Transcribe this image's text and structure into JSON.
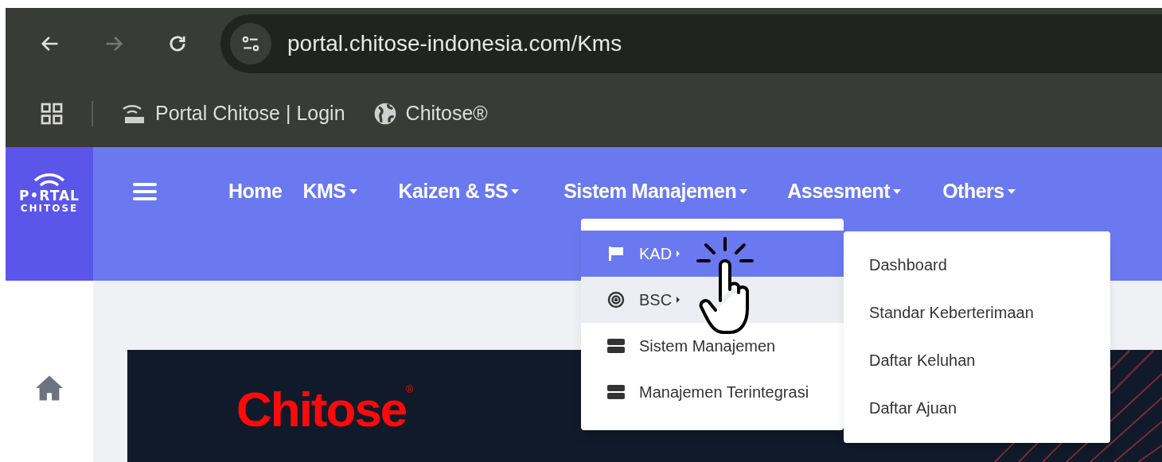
{
  "browser": {
    "url": "portal.chitose-indonesia.com/Kms",
    "bookmarks": [
      {
        "kind": "portal",
        "label": "Portal Chitose | Login"
      },
      {
        "kind": "globe",
        "label": "Chitose®"
      }
    ]
  },
  "logo": {
    "line1": "P•RTAL",
    "line2": "CHITOSE"
  },
  "nav": [
    {
      "label": "Home",
      "dropdown": false
    },
    {
      "label": "KMS",
      "dropdown": true
    },
    {
      "label": "Kaizen & 5S",
      "dropdown": true
    },
    {
      "label": "Sistem Manajemen",
      "dropdown": true
    },
    {
      "label": "Assesment",
      "dropdown": true
    },
    {
      "label": "Others",
      "dropdown": true
    }
  ],
  "menu": [
    {
      "kind": "flag",
      "label": "KAD",
      "submenu": true,
      "selected": true,
      "hovered": false
    },
    {
      "kind": "target",
      "label": "BSC",
      "submenu": true,
      "selected": false,
      "hovered": true
    },
    {
      "kind": "server",
      "label": "Sistem Manajemen",
      "submenu": false,
      "selected": false,
      "hovered": false
    },
    {
      "kind": "server",
      "label": "Manajemen Terintegrasi",
      "submenu": false,
      "selected": false,
      "hovered": false
    }
  ],
  "submenu": [
    "Dashboard",
    "Standar Keberterimaan",
    "Daftar Keluhan",
    "Daftar Ajuan"
  ],
  "banner": {
    "title": "Chitose",
    "mark": "®"
  }
}
